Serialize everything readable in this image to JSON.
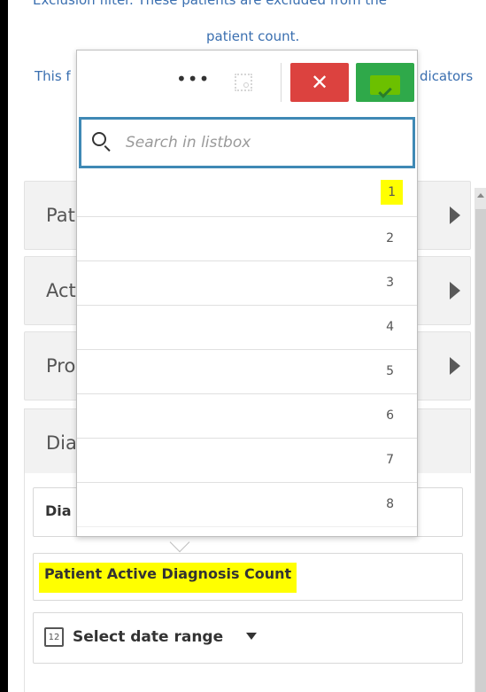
{
  "background_text": {
    "line1": "Exclusion filter. These patients are excluded from the",
    "line2": "patient count.",
    "line3_left": "This f",
    "line3_right": "dicators"
  },
  "panels": [
    {
      "label": "Pat"
    },
    {
      "label": "Act"
    },
    {
      "label": "Pro"
    },
    {
      "label": "Dia"
    }
  ],
  "diagnosis_fields": {
    "field1": "Dia",
    "field2": "Patient Active Diagnosis Count",
    "date_range": "Select date range",
    "calendar_icon_text": "12"
  },
  "popup": {
    "more_icon": "•••",
    "cancel_icon": "✕",
    "search_placeholder": "Search in listbox",
    "items": [
      "1",
      "2",
      "3",
      "4",
      "5",
      "6",
      "7",
      "8"
    ]
  },
  "colors": {
    "link_text": "#3a6fb0",
    "cancel": "#dc423f",
    "confirm": "#2fa94a",
    "highlight": "#ffff00",
    "search_border": "#3f89b5"
  }
}
